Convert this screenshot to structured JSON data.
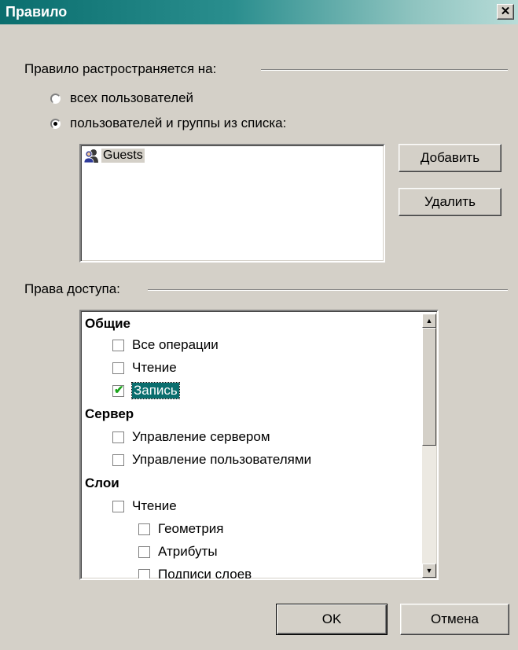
{
  "window": {
    "title": "Правило",
    "close_glyph": "✕"
  },
  "applies_to": {
    "label": "Правило растространяется на:",
    "options": [
      {
        "label": "всех пользователей",
        "checked": false
      },
      {
        "label": "пользователей и группы из списка:",
        "checked": true
      }
    ],
    "principals": [
      {
        "name": "Guests",
        "icon": "user-group-icon"
      }
    ],
    "add_button": "Добавить",
    "remove_button": "Удалить"
  },
  "permissions": {
    "label": "Права доступа:",
    "tree": [
      {
        "type": "category",
        "label": "Общие"
      },
      {
        "type": "item",
        "label": "Все операции",
        "checked": false,
        "level": 1
      },
      {
        "type": "item",
        "label": "Чтение",
        "checked": false,
        "level": 1
      },
      {
        "type": "item",
        "label": "Запись",
        "checked": true,
        "level": 1,
        "selected": true
      },
      {
        "type": "category",
        "label": "Сервер"
      },
      {
        "type": "item",
        "label": "Управление сервером",
        "checked": false,
        "level": 1
      },
      {
        "type": "item",
        "label": "Управление пользователями",
        "checked": false,
        "level": 1
      },
      {
        "type": "category",
        "label": "Слои"
      },
      {
        "type": "item",
        "label": "Чтение",
        "checked": false,
        "level": 1
      },
      {
        "type": "item",
        "label": "Геометрия",
        "checked": false,
        "level": 2
      },
      {
        "type": "item",
        "label": "Атрибуты",
        "checked": false,
        "level": 2
      },
      {
        "type": "item",
        "label": "Подписи слоев",
        "checked": false,
        "level": 2
      }
    ],
    "scroll_up_glyph": "▲",
    "scroll_down_glyph": "▼"
  },
  "footer": {
    "ok": "OK",
    "cancel": "Отмена"
  },
  "colors": {
    "accent": "#0a6e6e",
    "check": "#1aa31a",
    "face": "#d4d0c8"
  }
}
